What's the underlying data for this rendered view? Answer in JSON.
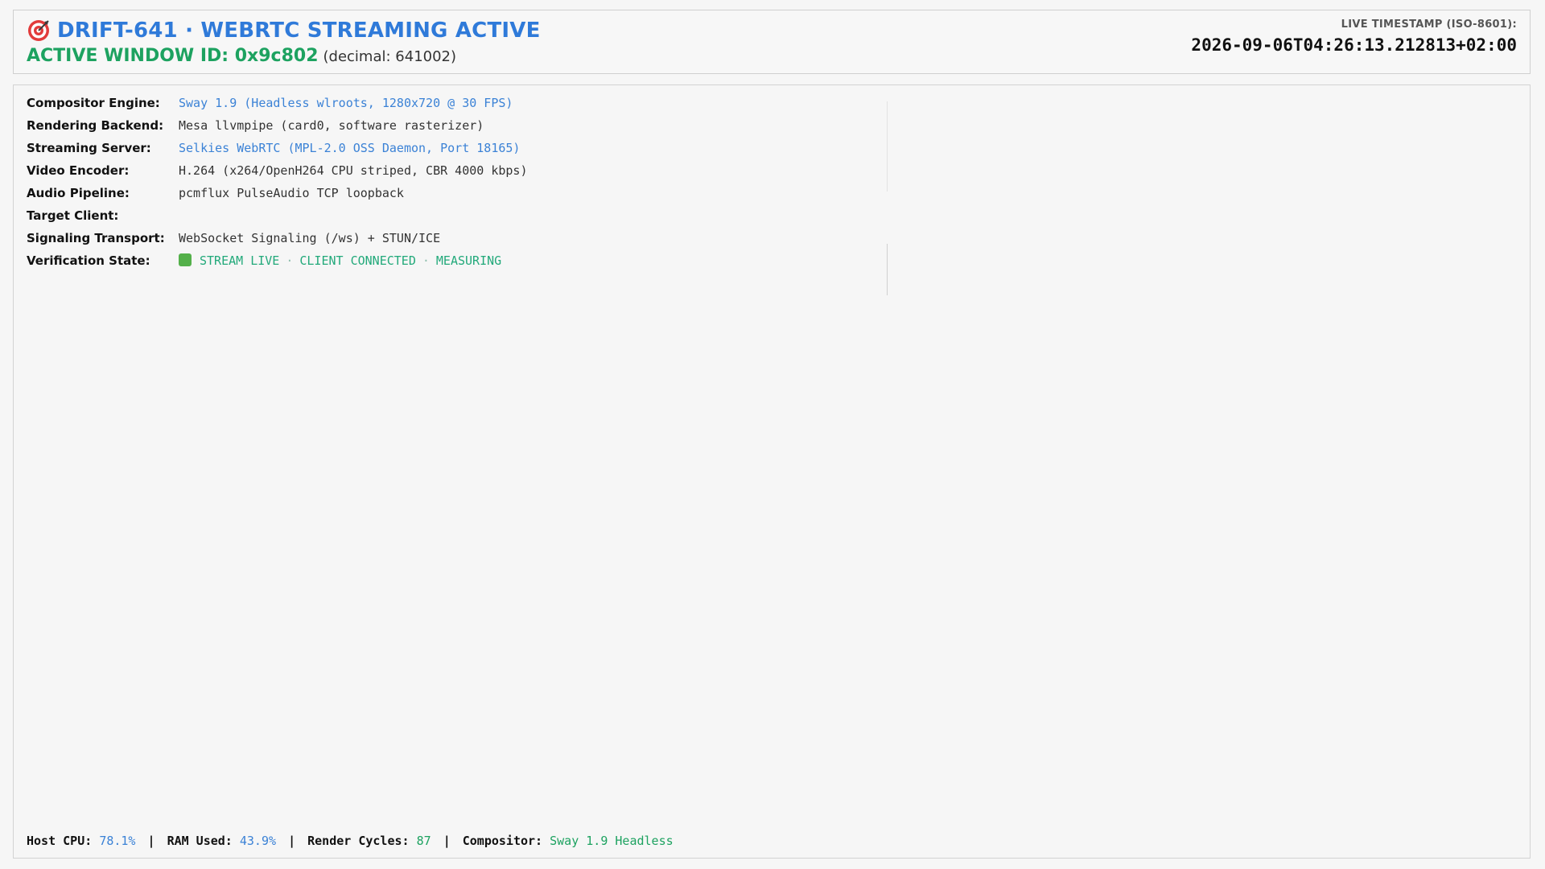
{
  "header": {
    "title": "DRIFT-641 · WEBRTC STREAMING ACTIVE",
    "window_id_label": "ACTIVE WINDOW ID: 0x9c802",
    "window_id_decimal": "(decimal: 641002)",
    "timestamp_label": "LIVE TIMESTAMP (ISO-8601):",
    "timestamp_value": "2026-09-06T04:26:13.212813+02:00",
    "title_icon": "target-icon"
  },
  "info": {
    "compositor_label": "Compositor Engine:",
    "compositor_value": "Sway 1.9 (Headless wlroots, 1280x720 @ 30 FPS)",
    "rendering_label": "Rendering Backend:",
    "rendering_value": "Mesa llvmpipe (card0, software rasterizer)",
    "streaming_label": "Streaming Server:",
    "streaming_value": "Selkies WebRTC (MPL-2.0 OSS Daemon, Port 18165)",
    "encoder_label": "Video Encoder:",
    "encoder_value": "H.264 (x264/OpenH264 CPU striped, CBR 4000 kbps)",
    "audio_label": "Audio Pipeline:",
    "audio_value": "pcmflux PulseAudio TCP loopback",
    "target_label": "Target Client:",
    "target_value": "",
    "signaling_label": "Signaling Transport:",
    "signaling_value": "WebSocket Signaling (/ws) + STUN/ICE",
    "verification_label": "Verification State:",
    "verification_parts": [
      "STREAM LIVE",
      "CLIENT CONNECTED",
      "MEASURING"
    ],
    "verification_sep": "·"
  },
  "footer": {
    "cpu_label": "Host CPU:",
    "cpu_value": "78.1%",
    "ram_label": "RAM Used:",
    "ram_value": "43.9%",
    "cycles_label": "Render Cycles:",
    "cycles_value": "87",
    "compositor_label": "Compositor:",
    "compositor_value": "Sway 1.9 Headless",
    "separator": "|"
  },
  "colors": {
    "title_blue": "#2f7ad9",
    "id_green": "#1da260",
    "value_blue": "#3b82d6",
    "status_green": "#22a97a",
    "status_dot": "#54b04a"
  }
}
